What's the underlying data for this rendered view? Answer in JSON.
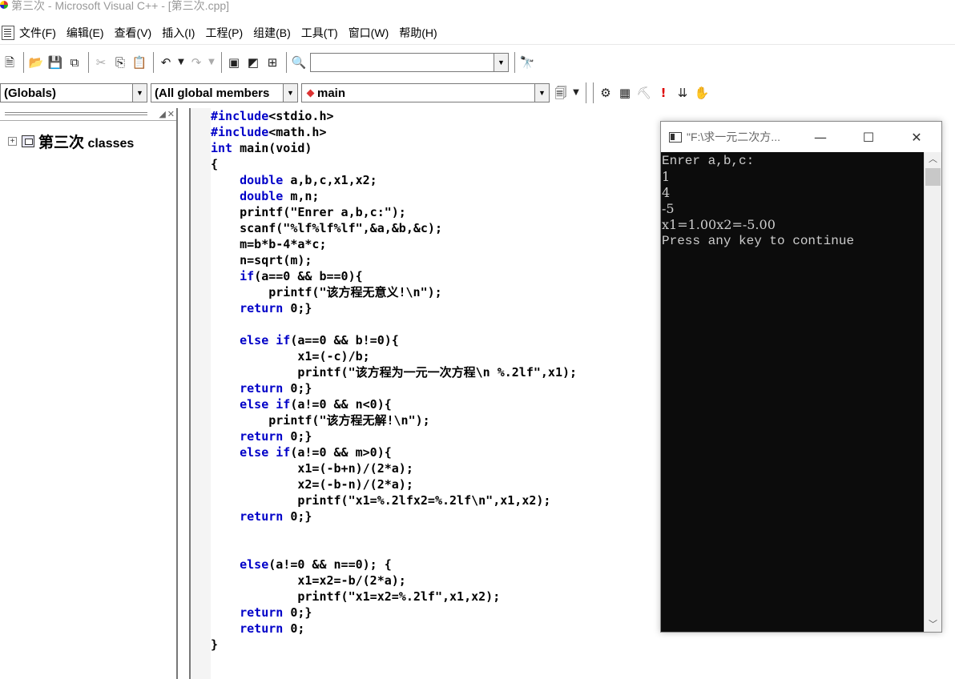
{
  "window": {
    "title": "第三次 - Microsoft Visual C++ - [第三次.cpp]"
  },
  "menubar": {
    "items": [
      {
        "label": "文件(F)"
      },
      {
        "label": "编辑(E)"
      },
      {
        "label": "查看(V)"
      },
      {
        "label": "插入(I)"
      },
      {
        "label": "工程(P)"
      },
      {
        "label": "组建(B)"
      },
      {
        "label": "工具(T)"
      },
      {
        "label": "窗口(W)"
      },
      {
        "label": "帮助(H)"
      }
    ]
  },
  "toolbar2": {
    "scope_combo": "(Globals)",
    "members_combo": "(All global members",
    "function_combo": "main"
  },
  "workspace": {
    "tree_root_label": "第三次",
    "tree_root_suffix": " classes"
  },
  "editor": {
    "lines": [
      {
        "text": "#include<stdio.h>",
        "kw": "#include",
        "rest": "<stdio.h>"
      },
      {
        "kw": "#include",
        "rest": "<math.h>"
      },
      {
        "kw": "int",
        "rest": " main(void)"
      },
      {
        "kw": "",
        "rest": "{"
      },
      {
        "pre": "    ",
        "kw": "double",
        "rest": " a,b,c,x1,x2;"
      },
      {
        "pre": "    ",
        "kw": "double",
        "rest": " m,n;"
      },
      {
        "pre": "    ",
        "kw": "",
        "rest": "printf(\"Enrer a,b,c:\");"
      },
      {
        "pre": "    ",
        "kw": "",
        "rest": "scanf(\"%lf%lf%lf\",&a,&b,&c);"
      },
      {
        "pre": "    ",
        "kw": "",
        "rest": "m=b*b-4*a*c;"
      },
      {
        "pre": "    ",
        "kw": "",
        "rest": "n=sqrt(m);"
      },
      {
        "pre": "    ",
        "kw": "if",
        "rest": "(a==0 && b==0){"
      },
      {
        "pre": "        ",
        "kw": "",
        "rest": "printf(\"该方程无意义!\\n\");"
      },
      {
        "pre": "    ",
        "kw": "return",
        "rest": " 0;}"
      },
      {
        "pre": "",
        "kw": "",
        "rest": ""
      },
      {
        "pre": "    ",
        "kw": "else if",
        "rest": "(a==0 && b!=0){"
      },
      {
        "pre": "            ",
        "kw": "",
        "rest": "x1=(-c)/b;"
      },
      {
        "pre": "            ",
        "kw": "",
        "rest": "printf(\"该方程为一元一次方程\\n %.2lf\",x1);"
      },
      {
        "pre": "    ",
        "kw": "return",
        "rest": " 0;}"
      },
      {
        "pre": "    ",
        "kw": "else if",
        "rest": "(a!=0 && n<0){"
      },
      {
        "pre": "        ",
        "kw": "",
        "rest": "printf(\"该方程无解!\\n\");"
      },
      {
        "pre": "    ",
        "kw": "return",
        "rest": " 0;}"
      },
      {
        "pre": "    ",
        "kw": "else if",
        "rest": "(a!=0 && m>0){"
      },
      {
        "pre": "            ",
        "kw": "",
        "rest": "x1=(-b+n)/(2*a);"
      },
      {
        "pre": "            ",
        "kw": "",
        "rest": "x2=(-b-n)/(2*a);"
      },
      {
        "pre": "            ",
        "kw": "",
        "rest": "printf(\"x1=%.2lfx2=%.2lf\\n\",x1,x2);"
      },
      {
        "pre": "    ",
        "kw": "return",
        "rest": " 0;}"
      },
      {
        "pre": "",
        "kw": "",
        "rest": ""
      },
      {
        "pre": "",
        "kw": "",
        "rest": ""
      },
      {
        "pre": "    ",
        "kw": "else",
        "rest": "(a!=0 && n==0); {"
      },
      {
        "pre": "            ",
        "kw": "",
        "rest": "x1=x2=-b/(2*a);"
      },
      {
        "pre": "            ",
        "kw": "",
        "rest": "printf(\"x1=x2=%.2lf\",x1,x2);"
      },
      {
        "pre": "    ",
        "kw": "return",
        "rest": " 0;}"
      },
      {
        "pre": "    ",
        "kw": "return",
        "rest": " 0;"
      },
      {
        "pre": "",
        "kw": "",
        "rest": "}"
      }
    ]
  },
  "console": {
    "title": "\"F:\\求一元二次方...",
    "minimize": "—",
    "maximize": "☐",
    "close": "✕",
    "lines": [
      {
        "text": "Enrer a,b,c:",
        "mono": true
      },
      {
        "text": "1",
        "mono": false
      },
      {
        "text": "4",
        "mono": false
      },
      {
        "text": "-5",
        "mono": false
      },
      {
        "text": "x1=1.00x2=-5.00",
        "mono": false
      },
      {
        "text": "Press any key to continue",
        "mono": true
      }
    ]
  },
  "colors": {
    "keyword": "#0000c8",
    "console_bg": "#0c0c0c",
    "console_text": "#cccccc"
  }
}
